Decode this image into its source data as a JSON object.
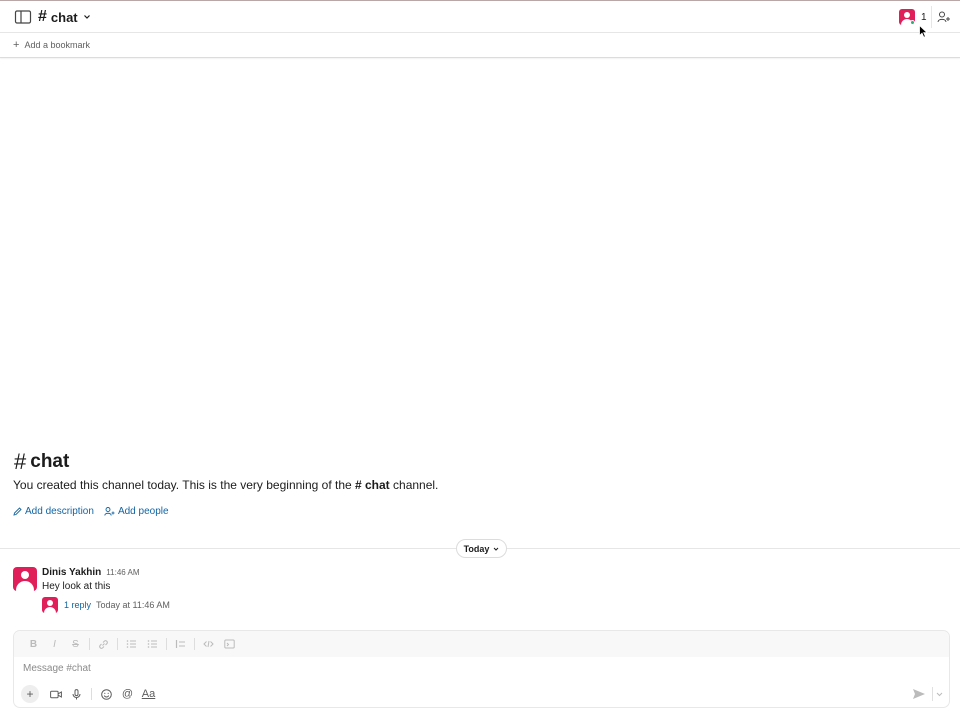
{
  "header": {
    "hash": "#",
    "channel_name": "chat",
    "member_count": "1"
  },
  "bookmarks": {
    "add_label": "Add a bookmark"
  },
  "intro": {
    "hash": "#",
    "title": "chat",
    "text_before": "You created this channel today. This is the very beginning of the ",
    "channel_ref": "# chat",
    "text_after": " channel.",
    "add_description": "Add description",
    "add_people": "Add people"
  },
  "divider": {
    "date_label": "Today"
  },
  "message": {
    "author": "Dinis Yakhin",
    "time": "11:46 AM",
    "text": "Hey look at this",
    "reply_count": "1 reply",
    "reply_time": "Today at 11:46 AM"
  },
  "composer": {
    "placeholder": "Message #chat",
    "format_buttons": [
      "B",
      "I",
      "S"
    ],
    "text_style_label": "Aa"
  },
  "colors": {
    "avatar": "#e01e5a",
    "link": "#1264a3",
    "online": "#2bac76"
  },
  "icons": [
    "sidebar-toggle-icon",
    "chevron-down-icon",
    "add-member-icon",
    "plus-icon",
    "pencil-icon",
    "add-person-icon",
    "send-icon",
    "video-icon",
    "mic-icon",
    "emoji-icon",
    "mention-icon",
    "link-icon",
    "bulleted-list-icon",
    "numbered-list-icon",
    "blockquote-icon",
    "code-icon",
    "code-block-icon"
  ]
}
